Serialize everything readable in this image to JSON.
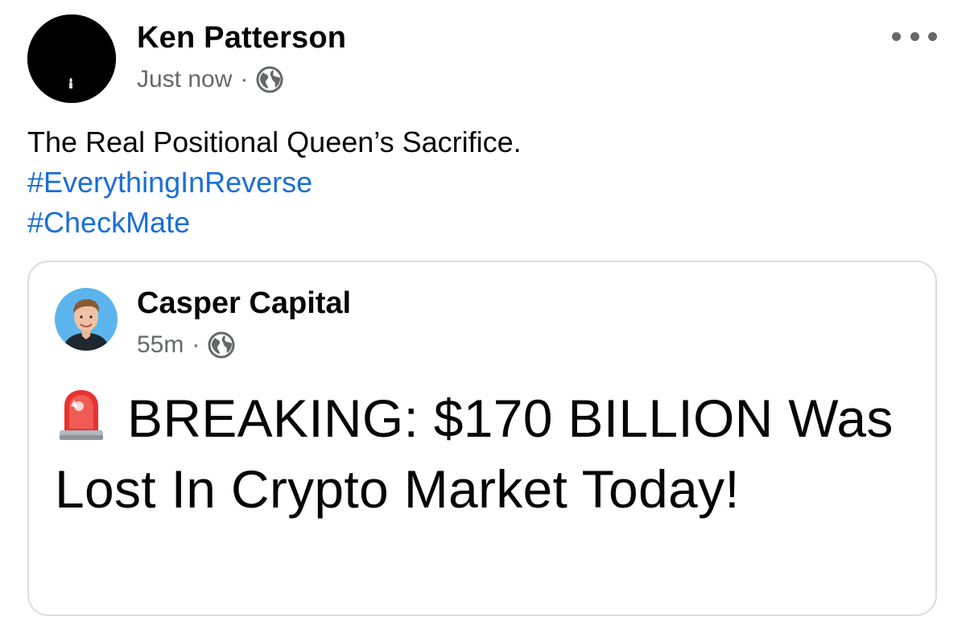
{
  "post": {
    "author": "Ken Patterson",
    "timestamp": "Just now",
    "separator": "·",
    "audience_icon": "globe-icon",
    "more_icon": "more-horizontal-icon",
    "text": "The Real Positional Queen’s Sacrifice.",
    "hashtags": [
      "#EverythingInReverse",
      "#CheckMate"
    ]
  },
  "shared_post": {
    "author": "Casper Capital",
    "timestamp": "55m",
    "separator": "·",
    "audience_icon": "globe-icon",
    "headline_icon": "siren-icon",
    "headline": "BREAKING: $170 BILLION Was Lost In Crypto Market Today!"
  },
  "colors": {
    "hashtag": "#1a6ed8",
    "secondary_text": "#65676b",
    "card_border": "#dadde1",
    "shared_avatar_bg": "#5bb5ec"
  }
}
